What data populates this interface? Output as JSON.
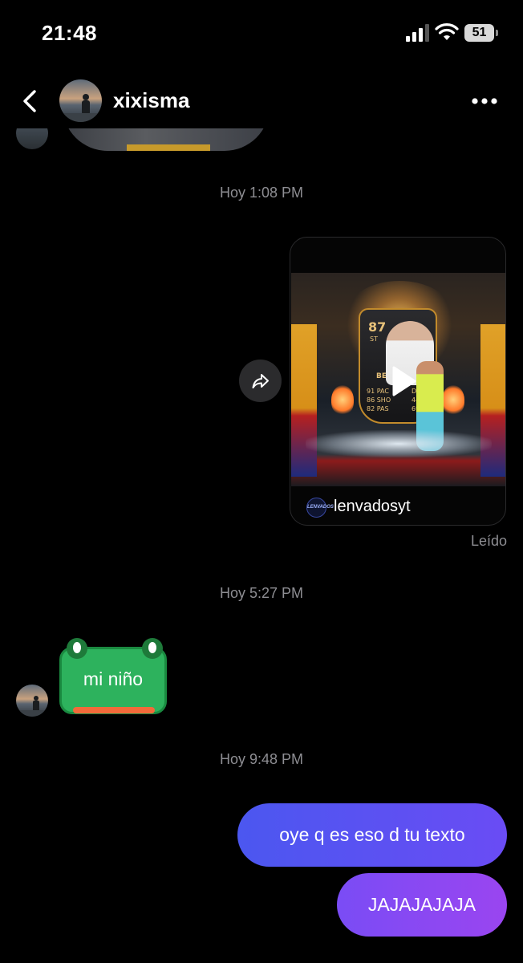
{
  "status_bar": {
    "time": "21:48",
    "battery": "51"
  },
  "header": {
    "contact_name": "xixisma",
    "back_icon": "chevron-left-icon",
    "more_icon": "ellipsis-icon"
  },
  "conversation": {
    "timestamps": [
      "Hoy 1:08 PM",
      "Hoy 5:27 PM",
      "Hoy 9:48 PM"
    ],
    "shared_video": {
      "creator": "lenvadosyt",
      "creator_logo_text": "LENVADOS",
      "card_rating": "87",
      "card_position": "ST",
      "card_name": "BEN",
      "card_stats_left": [
        "91 PAC",
        "86 SHO",
        "82 PAS"
      ],
      "card_stats_right": [
        "D",
        "44 D",
        "69 P"
      ]
    },
    "read_status": "Leído",
    "incoming_message": "mi niño",
    "outgoing_messages": [
      "oye q es eso d tu texto",
      "JAJAJAJAJA"
    ]
  },
  "colors": {
    "background": "#000000",
    "bubble_start": "#4b57f0",
    "bubble_end": "#9a45f0",
    "frog_green": "#2db25d",
    "meta_text": "#8e8e93"
  }
}
